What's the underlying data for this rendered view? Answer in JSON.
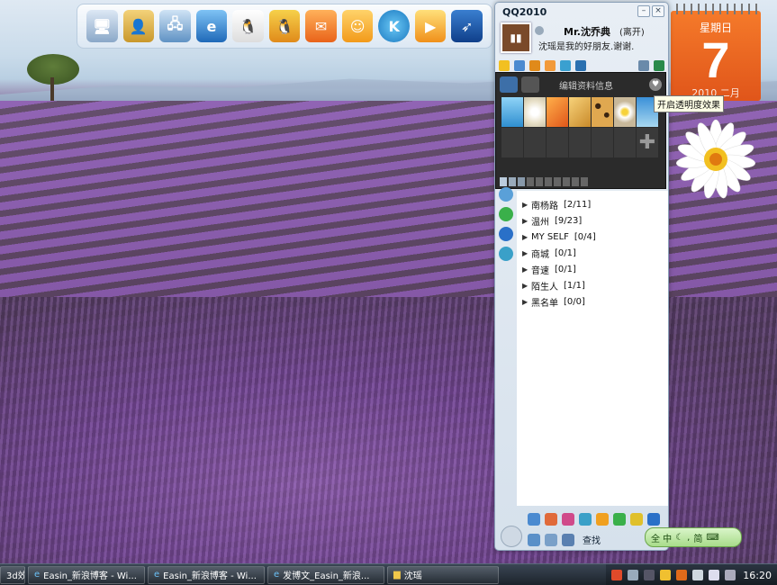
{
  "qq": {
    "title": "QQ2010",
    "nickname": "Mr.沈乔典",
    "status": "(离开)",
    "signature": "沈瑶是我的好朋友.谢谢."
  },
  "skin_popup": {
    "info_label": "编辑资料信息",
    "heart_icon": "heart-icon",
    "tooltip": "开启透明度效果"
  },
  "friend_groups": [
    {
      "name": "南杨路",
      "count": "[2/11]"
    },
    {
      "name": "温州",
      "count": "[9/23]"
    },
    {
      "name": "MY SELF",
      "count": "[0/4]"
    },
    {
      "name": "商城",
      "count": "[0/1]"
    },
    {
      "name": "音速",
      "count": "[0/1]"
    },
    {
      "name": "陌生人",
      "count": "[1/1]"
    },
    {
      "name": "黑名单",
      "count": "[0/0]"
    }
  ],
  "qq_bottom": {
    "find_label": "查找"
  },
  "calendar": {
    "weekday": "星期日",
    "day": "7",
    "month": "2010 二月"
  },
  "ime": {
    "label": "全 中"
  },
  "taskbar": {
    "tasks": [
      "3d效...",
      "Easin_新浪博客 - Wi...",
      "Easin_新浪博客 - Wi...",
      "发博文_Easin_新浪...",
      "沈瑶"
    ],
    "clock": "16:20"
  },
  "colors": {
    "calendar_orange": "#e8621f",
    "taskbar_dark": "#1c232b",
    "qq_frame": "#d6e1ec",
    "skin_dark": "#2b2b2b"
  }
}
